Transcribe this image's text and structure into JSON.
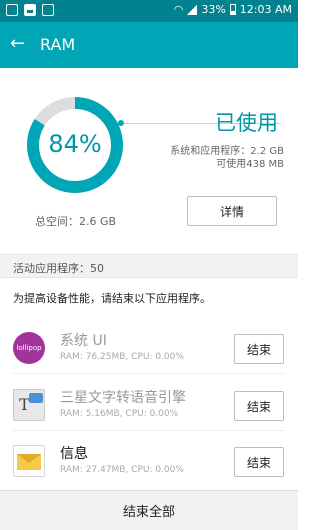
{
  "status_bar": {
    "battery": "33%",
    "time": "12:03 AM"
  },
  "app_bar": {
    "title": "RAM"
  },
  "summary": {
    "percent_used": 84,
    "percent_label": "84%",
    "used_label": "已使用",
    "system_apps": "系统和应用程序：2.2 GB",
    "available": "可使用438 MB",
    "details_button": "详情",
    "total_space": "总空间：2.6 GB",
    "colors": {
      "accent": "#00a6b5",
      "ring_track": "#dddddd"
    }
  },
  "section": {
    "active_apps": "活动应用程序：50"
  },
  "notice": "为提高设备性能，请结束以下应用程序。",
  "apps": [
    {
      "name": "系统 UI",
      "stats": "RAM: 76.25MB, CPU: 0.00%",
      "icon": "lollipop-icon",
      "icon_text": "lollipop",
      "end_label": "结束"
    },
    {
      "name": "三星文字转语音引擎",
      "stats": "RAM: 5.16MB, CPU: 0.00%",
      "icon": "text-to-speech-icon",
      "icon_text": "T",
      "end_label": "结束"
    },
    {
      "name": "信息",
      "stats": "RAM: 27.47MB, CPU: 0.00%",
      "icon": "messages-icon",
      "icon_text": "",
      "end_label": "结束"
    }
  ],
  "end_all_label": "结束全部"
}
